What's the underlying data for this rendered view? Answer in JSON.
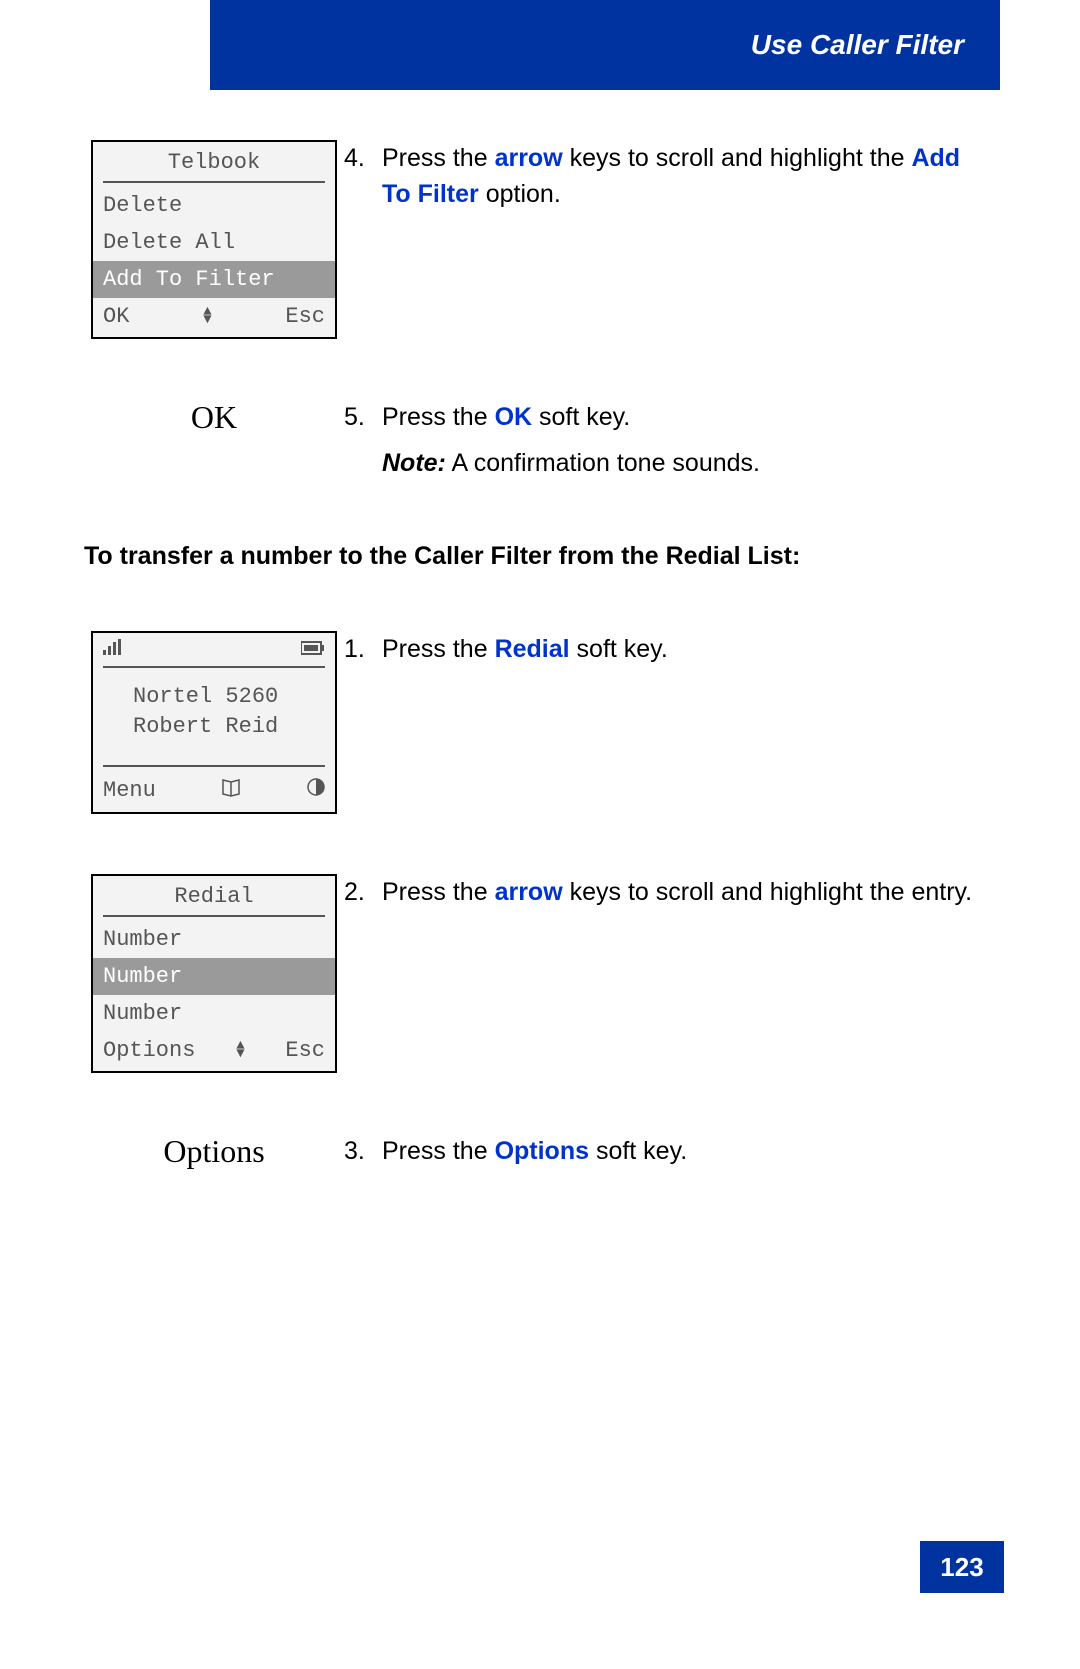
{
  "header": {
    "title": "Use Caller Filter"
  },
  "step4": {
    "screen": {
      "title": "Telbook",
      "items": [
        "Delete",
        "Delete All",
        "Add To Filter"
      ],
      "selected_index": 2,
      "left": "OK",
      "right": "Esc"
    },
    "num": "4.",
    "pre": "Press the ",
    "kw1": "arrow",
    "mid": " keys to scroll and highlight the ",
    "kw2": "Add To Filter",
    "post": " option."
  },
  "step5": {
    "label": "OK",
    "num": "5.",
    "pre": "Press the ",
    "kw": "OK",
    "post": " soft key.",
    "note_label": "Note:",
    "note_body": " A confirmation tone sounds."
  },
  "section_heading": "To transfer a number to the Caller Filter from the Redial List:",
  "step1b": {
    "screen": {
      "line1": "Nortel 5260",
      "line2": "Robert Reid",
      "left": "Menu"
    },
    "num": "1.",
    "pre": "Press the ",
    "kw": "Redial",
    "post": " soft key."
  },
  "step2b": {
    "screen": {
      "title": "Redial",
      "items": [
        "Number",
        "Number",
        "Number"
      ],
      "selected_index": 1,
      "left": "Options",
      "right": "Esc"
    },
    "num": "2.",
    "pre": "Press the ",
    "kw": "arrow",
    "post": " keys to scroll and highlight the entry."
  },
  "step3b": {
    "label": "Options",
    "num": "3.",
    "pre": "Press the ",
    "kw": "Options",
    "post": " soft key."
  },
  "page_number": "123"
}
